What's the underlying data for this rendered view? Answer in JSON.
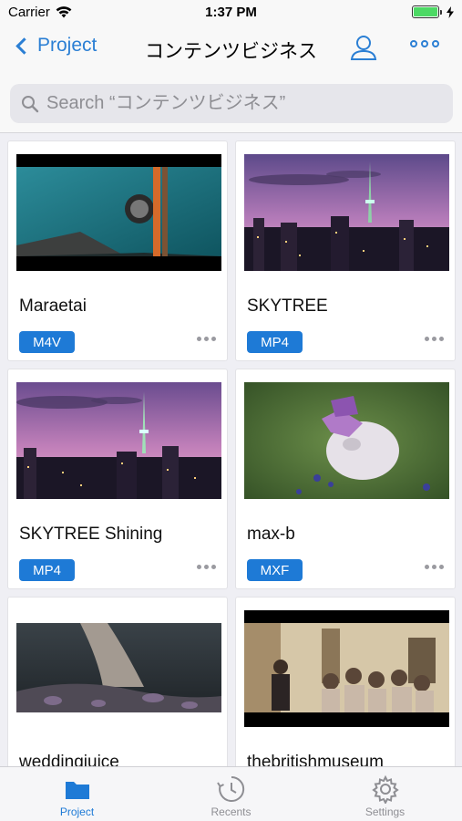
{
  "status_bar": {
    "carrier": "Carrier",
    "time": "1:37 PM"
  },
  "nav": {
    "back_label": "Project",
    "title": "コンテンツビジネス"
  },
  "search": {
    "placeholder": "Search “コンテンツビジネス”"
  },
  "cards": [
    {
      "title": "Maraetai",
      "format": "M4V"
    },
    {
      "title": "SKYTREE",
      "format": "MP4"
    },
    {
      "title": "SKYTREE Shining",
      "format": "MP4"
    },
    {
      "title": "max-b",
      "format": "MXF"
    },
    {
      "title": "weddingjuice",
      "format": ""
    },
    {
      "title": "thebritishmuseum",
      "format": ""
    }
  ],
  "tabs": [
    {
      "label": "Project",
      "icon": "folder-icon"
    },
    {
      "label": "Recents",
      "icon": "clock-icon"
    },
    {
      "label": "Settings",
      "icon": "gear-icon"
    }
  ],
  "colors": {
    "accent": "#1e7ad6",
    "badge": "#1e7ad6",
    "battery": "#4cd964"
  }
}
